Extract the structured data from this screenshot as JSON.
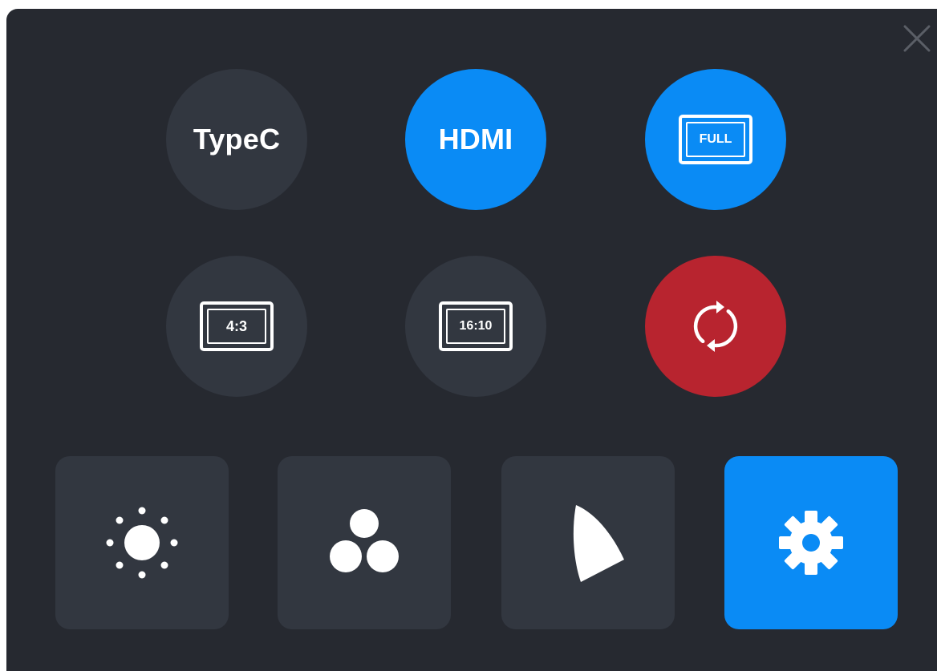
{
  "window": {
    "close_icon": "close-icon"
  },
  "input_sources": [
    {
      "label": "TypeC",
      "active": false
    },
    {
      "label": "HDMI",
      "active": true
    }
  ],
  "aspect": {
    "full_label": "FULL",
    "ratio_4_3_label": "4:3",
    "ratio_16_10_label": "16:10"
  },
  "actions": {
    "rotate_icon": "rotate-icon"
  },
  "tiles": [
    {
      "icon": "brightness-icon",
      "active": false
    },
    {
      "icon": "color-icon",
      "active": false
    },
    {
      "icon": "gamma-icon",
      "active": false
    },
    {
      "icon": "settings-gear-icon",
      "active": true
    }
  ],
  "colors": {
    "panel": "#262930",
    "button": "#323740",
    "accent": "#0a8bf5",
    "danger": "#b8242f",
    "close": "#5a5e66"
  }
}
